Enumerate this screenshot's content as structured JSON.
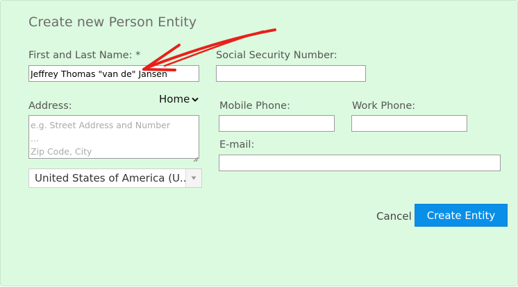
{
  "dialog": {
    "title": "Create new Person Entity"
  },
  "form": {
    "name_label": "First and Last Name: *",
    "name_value": "Jeffrey Thomas \"van de\" Jansen",
    "ssn_label": "Social Security Number:",
    "ssn_value": "",
    "address_label": "Address:",
    "address_type": "Home",
    "address_placeholder": "e.g. Street Address and Number\n...\nZip Code, City",
    "country_value": "United States of America (U...",
    "mobile_label": "Mobile Phone:",
    "mobile_value": "",
    "work_label": "Work Phone:",
    "work_value": "",
    "email_label": "E-mail:",
    "email_value": ""
  },
  "actions": {
    "cancel_label": "Cancel",
    "create_label": "Create Entity"
  },
  "icons": {
    "address_type_dropdown": "chevron-down-icon",
    "country_dropdown": "triangle-down-icon",
    "textarea_resize": "resize-grip-icon",
    "annotation": "red-arrow-icon"
  },
  "colors": {
    "background": "#dcfadf",
    "primary_button": "#0a8fe8",
    "annotation_arrow": "#e8201a"
  }
}
